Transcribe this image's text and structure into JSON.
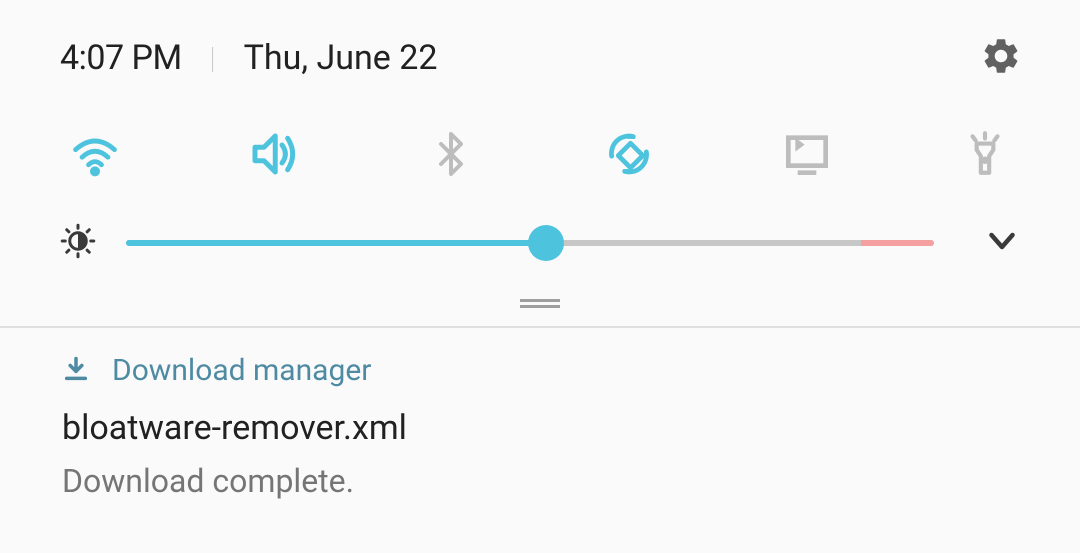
{
  "statusBar": {
    "time": "4:07 PM",
    "date": "Thu, June 22"
  },
  "toggles": {
    "wifi": {
      "active": true
    },
    "sound": {
      "active": true
    },
    "bluetooth": {
      "active": false
    },
    "autoRotate": {
      "active": true
    },
    "cast": {
      "active": false
    },
    "flashlight": {
      "active": false
    }
  },
  "brightness": {
    "value": 52
  },
  "notification": {
    "appName": "Download manager",
    "title": "bloatware-remover.xml",
    "subtitle": "Download complete."
  },
  "colors": {
    "accent": "#4dc3de",
    "accentDark": "#4e8ba3",
    "inactive": "#9e9e9e",
    "inactiveLight": "#bdbdbd",
    "text": "#212121",
    "textSecondary": "#757575"
  }
}
